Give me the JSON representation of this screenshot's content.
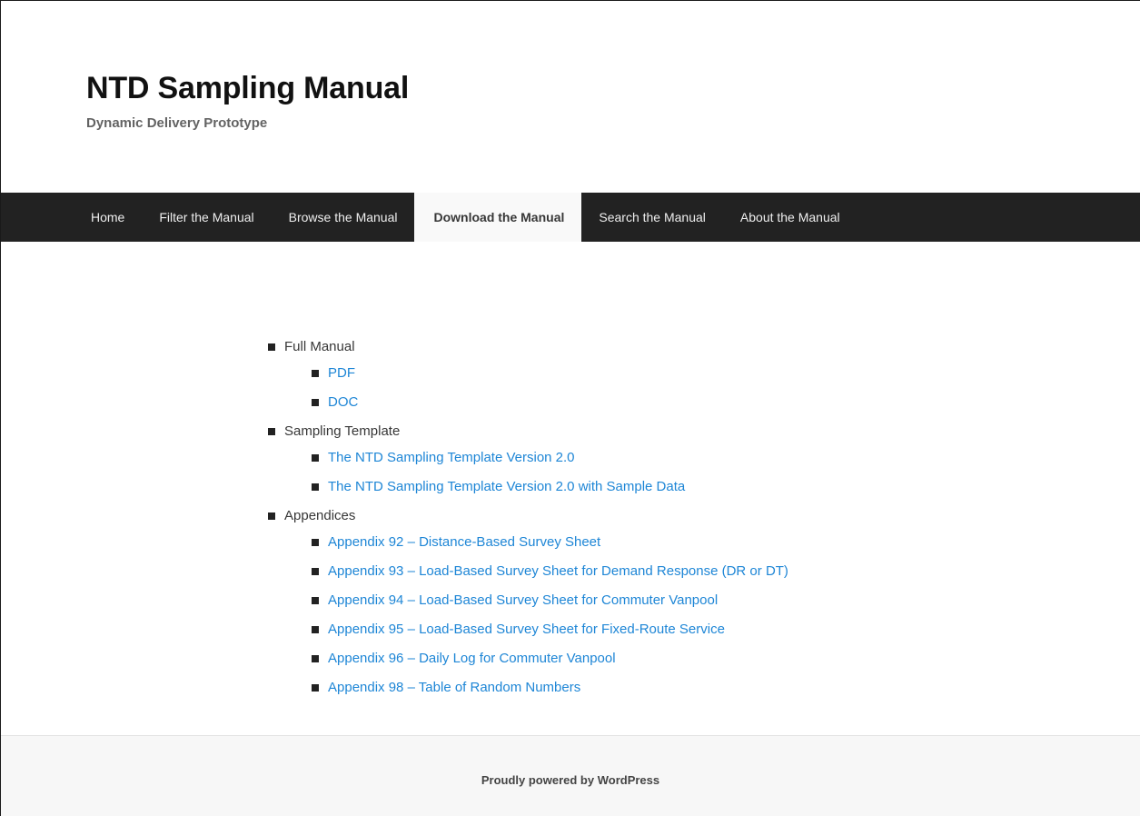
{
  "header": {
    "title": "NTD Sampling Manual",
    "description": "Dynamic Delivery Prototype"
  },
  "nav": {
    "items": [
      {
        "label": "Home"
      },
      {
        "label": "Filter the Manual"
      },
      {
        "label": "Browse the Manual"
      },
      {
        "label": "Download the Manual",
        "active": true
      },
      {
        "label": "Search the Manual"
      },
      {
        "label": "About the Manual"
      }
    ]
  },
  "downloads": {
    "sections": [
      {
        "label": "Full Manual",
        "links": [
          "PDF",
          "DOC"
        ]
      },
      {
        "label": "Sampling Template",
        "links": [
          "The NTD Sampling Template Version 2.0",
          "The NTD Sampling Template Version 2.0 with Sample Data"
        ]
      },
      {
        "label": "Appendices",
        "links": [
          "Appendix 92 – Distance-Based Survey Sheet",
          "Appendix 93 – Load-Based Survey Sheet for Demand Response (DR or DT)",
          "Appendix 94 – Load-Based Survey Sheet for Commuter Vanpool",
          "Appendix 95 – Load-Based Survey Sheet for Fixed-Route Service",
          "Appendix 96 – Daily Log for Commuter Vanpool",
          "Appendix 98 – Table of Random Numbers"
        ]
      }
    ]
  },
  "footer": {
    "credit": "Proudly powered by WordPress"
  },
  "colors": {
    "nav_background": "#222222",
    "link": "#1e86d6",
    "footer_background": "#f7f7f7"
  }
}
